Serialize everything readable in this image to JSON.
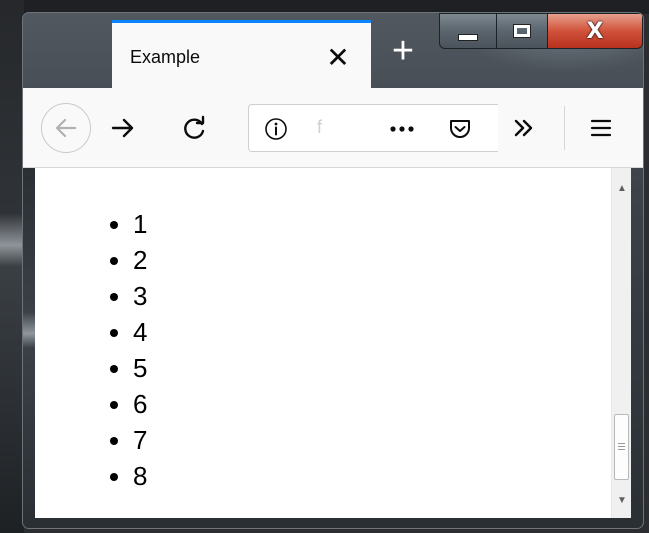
{
  "tab": {
    "title": "Example",
    "close_glyph": "✕"
  },
  "newtab": {
    "glyph": "+"
  },
  "caption": {
    "minimize_icon": "minimize-icon",
    "maximize_icon": "maximize-icon",
    "close_glyph": "X"
  },
  "toolbar": {
    "url_text": "f",
    "icons": [
      "back-arrow-icon",
      "forward-arrow-icon",
      "reload-icon",
      "info-icon",
      "page-actions-icon",
      "pocket-icon",
      "overflow-chevron-icon",
      "hamburger-menu-icon"
    ]
  },
  "content": {
    "items": [
      "1",
      "2",
      "3",
      "4",
      "5",
      "6",
      "7",
      "8"
    ]
  },
  "colors": {
    "tab_accent": "#0a84ff",
    "close_button": "#d1523a",
    "toolbar_bg": "#f9f9fa"
  }
}
